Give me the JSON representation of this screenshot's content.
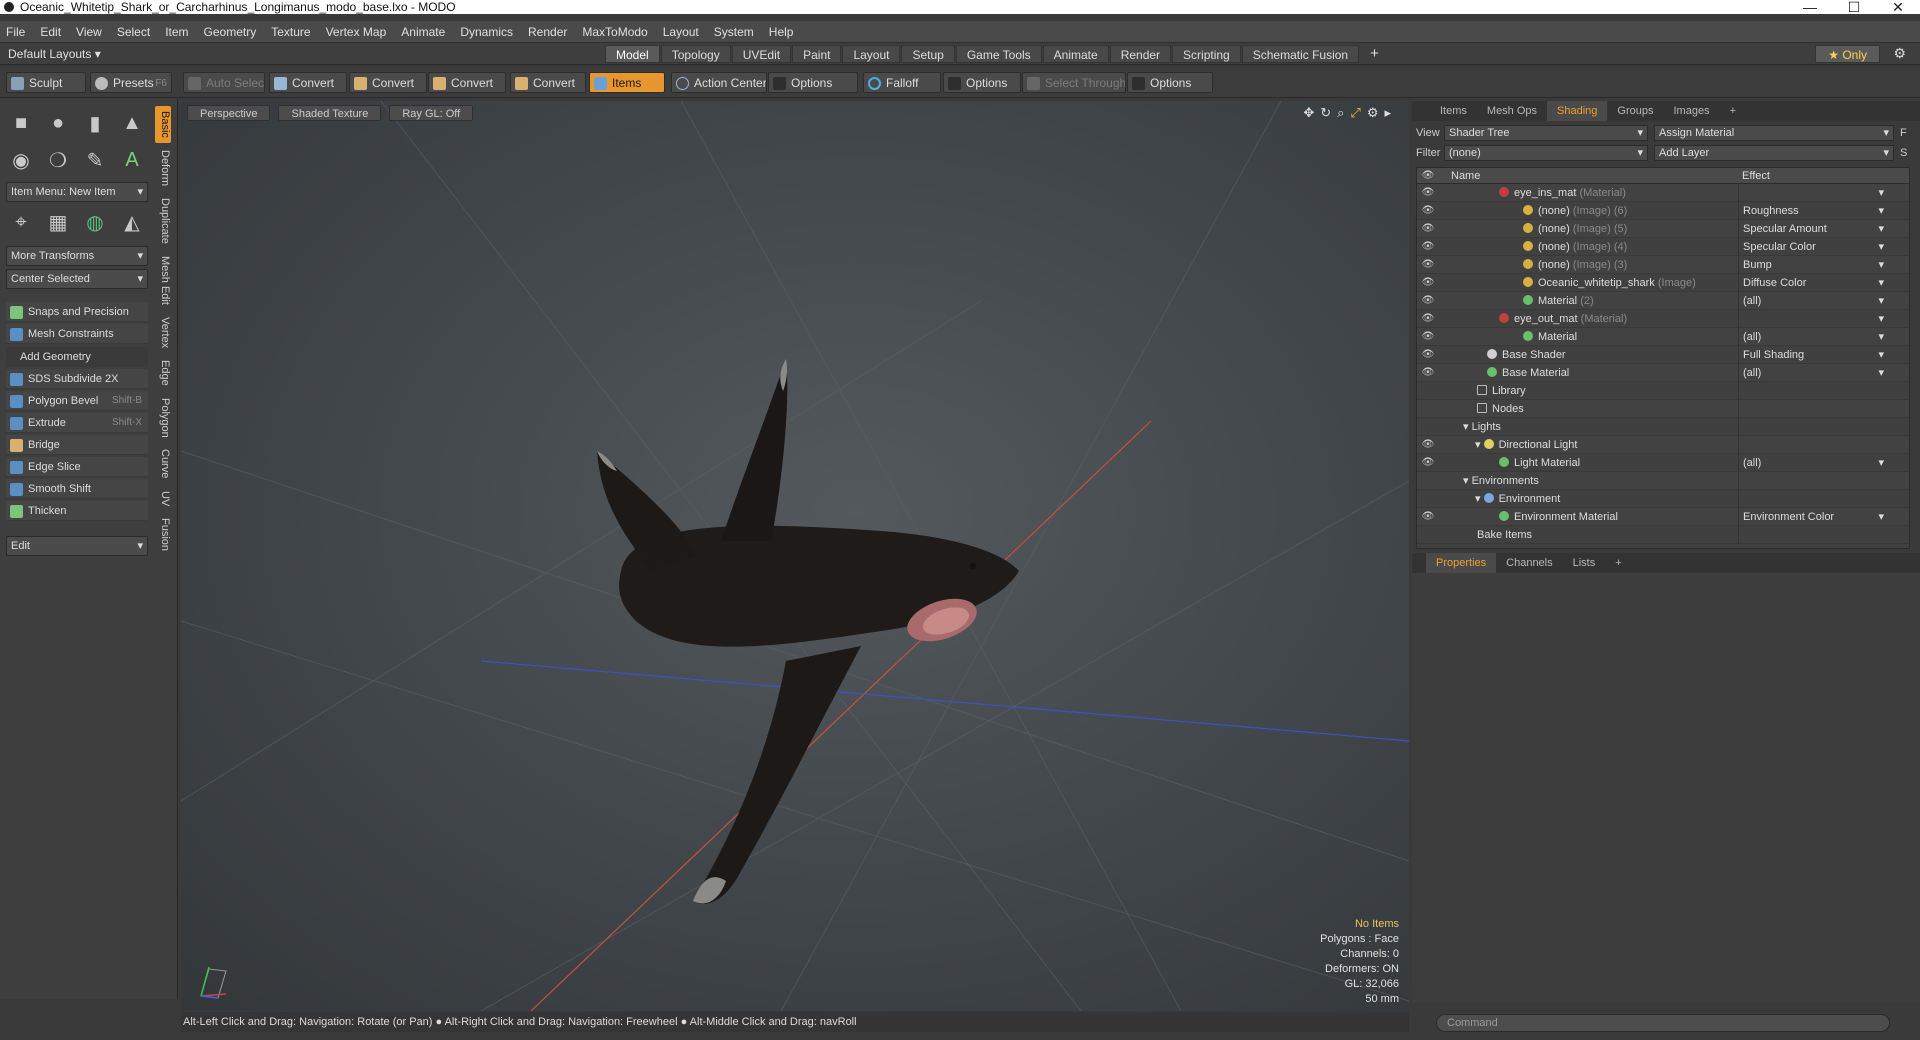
{
  "window": {
    "title": "Oceanic_Whitetip_Shark_or_Carcharhinus_Longimanus_modo_base.lxo - MODO",
    "controls": [
      "—",
      "☐",
      "✕"
    ]
  },
  "menu": [
    "File",
    "Edit",
    "View",
    "Select",
    "Item",
    "Geometry",
    "Texture",
    "Vertex Map",
    "Animate",
    "Dynamics",
    "Render",
    "MaxToModo",
    "Layout",
    "System",
    "Help"
  ],
  "layouts": {
    "dropdown": "Default Layouts ▾",
    "tabs": [
      "Model",
      "Topology",
      "UVEdit",
      "Paint",
      "Layout",
      "Setup",
      "Game Tools",
      "Animate",
      "Render",
      "Scripting",
      "Schematic Fusion",
      "+"
    ],
    "active": "Model",
    "only": "★ Only"
  },
  "toolbar": {
    "sculpt": "Sculpt",
    "presets": "Presets",
    "presets_key": "F6",
    "auto_select": "Auto Select",
    "convert1": "Convert",
    "convert2": "Convert",
    "convert3": "Convert",
    "convert4": "Convert",
    "items": "Items",
    "action_center": "Action Center",
    "options1": "Options",
    "falloff": "Falloff",
    "options2": "Options",
    "select_through": "Select Through",
    "options3": "Options"
  },
  "left": {
    "vtabs": [
      "Basic",
      "Deform",
      "Duplicate",
      "Mesh Edit",
      "Vertex",
      "Edge",
      "Polygon",
      "Curve",
      "UV",
      "Fusion"
    ],
    "item_menu": "Item Menu: New Item",
    "more_transforms": "More Transforms",
    "center_selected": "Center Selected",
    "snaps": "Snaps and Precision",
    "mesh_constraints": "Mesh Constraints",
    "add_geometry": "Add Geometry",
    "tools": [
      {
        "label": "SDS Subdivide 2X",
        "key": ""
      },
      {
        "label": "Polygon Bevel",
        "key": "Shift-B"
      },
      {
        "label": "Extrude",
        "key": "Shift-X"
      },
      {
        "label": "Bridge",
        "key": ""
      },
      {
        "label": "Edge Slice",
        "key": ""
      },
      {
        "label": "Smooth Shift",
        "key": ""
      },
      {
        "label": "Thicken",
        "key": ""
      }
    ],
    "edit": "Edit"
  },
  "viewport": {
    "perspective": "Perspective",
    "shading": "Shaded Texture",
    "raygl": "Ray GL: Off",
    "info": {
      "items": "No Items",
      "polygons": "Polygons : Face",
      "channels": "Channels: 0",
      "deformers": "Deformers: ON",
      "gl": "GL: 32,066",
      "scale": "50 mm"
    }
  },
  "status": "Alt-Left Click and Drag: Navigation: Rotate (or Pan) ● Alt-Right Click and Drag: Navigation: Freewheel ● Alt-Middle Click and Drag: navRoll",
  "right": {
    "tabs": [
      "Items",
      "Mesh Ops",
      "Shading",
      "Groups",
      "Images",
      "+"
    ],
    "active_tab": "Shading",
    "view_label": "View",
    "view_value": "Shader Tree",
    "assign": "Assign Material",
    "assign_key": "F",
    "filter_label": "Filter",
    "filter_value": "(none)",
    "add_layer": "Add Layer",
    "add_layer_key": "S",
    "col_name": "Name",
    "col_effect": "Effect",
    "rows": [
      {
        "name": "eye_ins_mat",
        "type": "(Material)",
        "effect": ""
      },
      {
        "name": "(none)",
        "type": "(Image) (6)",
        "effect": "Roughness"
      },
      {
        "name": "(none)",
        "type": "(Image) (5)",
        "effect": "Specular Amount"
      },
      {
        "name": "(none)",
        "type": "(Image) (4)",
        "effect": "Specular Color"
      },
      {
        "name": "(none)",
        "type": "(Image) (3)",
        "effect": "Bump"
      },
      {
        "name": "Oceanic_whitetip_shark",
        "type": "(Image)",
        "effect": "Diffuse Color"
      },
      {
        "name": "Material",
        "type": "(2)",
        "effect": "(all)"
      },
      {
        "name": "eye_out_mat",
        "type": "(Material)",
        "effect": ""
      },
      {
        "name": "Material",
        "type": "",
        "effect": "(all)"
      },
      {
        "name": "Base Shader",
        "type": "",
        "effect": "Full Shading"
      },
      {
        "name": "Base Material",
        "type": "",
        "effect": "(all)"
      },
      {
        "name": "Library",
        "type": "",
        "effect": ""
      },
      {
        "name": "Nodes",
        "type": "",
        "effect": ""
      },
      {
        "name": "Lights",
        "type": "",
        "effect": ""
      },
      {
        "name": "Directional Light",
        "type": "",
        "effect": ""
      },
      {
        "name": "Light Material",
        "type": "",
        "effect": "(all)"
      },
      {
        "name": "Environments",
        "type": "",
        "effect": ""
      },
      {
        "name": "Environment",
        "type": "",
        "effect": ""
      },
      {
        "name": "Environment Material",
        "type": "",
        "effect": "Environment Color"
      },
      {
        "name": "Bake Items",
        "type": "",
        "effect": ""
      }
    ],
    "prop_tabs": [
      "Properties",
      "Channels",
      "Lists",
      "+"
    ],
    "command_placeholder": "Command"
  }
}
